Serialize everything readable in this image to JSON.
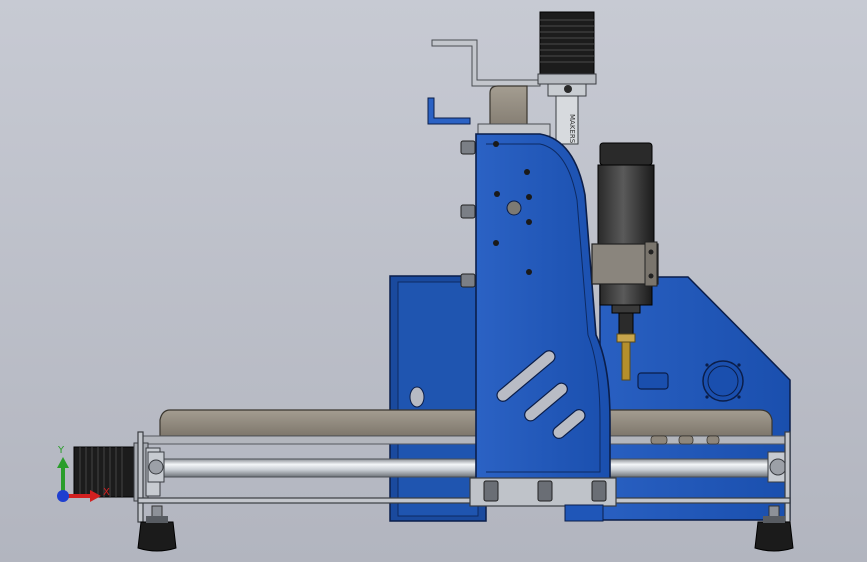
{
  "viewport": {
    "background_top": "#c7cad3",
    "background_bottom": "#b2b5bf"
  },
  "model": {
    "components": [
      "base-plate",
      "side-panel",
      "gantry-plate",
      "z-axis-stepper-motor",
      "spindle-motor",
      "spindle-clamp",
      "x-axis-stepper-motor",
      "linear-rod",
      "support-feet",
      "cable-bracket",
      "collet-and-bit"
    ],
    "colors": {
      "blue_part": "#1f56b8",
      "blue_dark": "#103f8f",
      "grey_part": "#8e877c",
      "motor_black": "#1c1c1c",
      "rod_silver": "#d9dde2"
    },
    "z_motor_label": "MAKERS"
  },
  "triad": {
    "y_label": "Y",
    "x_label": "X",
    "y_color": "#2a9d2a",
    "x_color": "#d22020",
    "z_color": "#1f3fd0"
  }
}
